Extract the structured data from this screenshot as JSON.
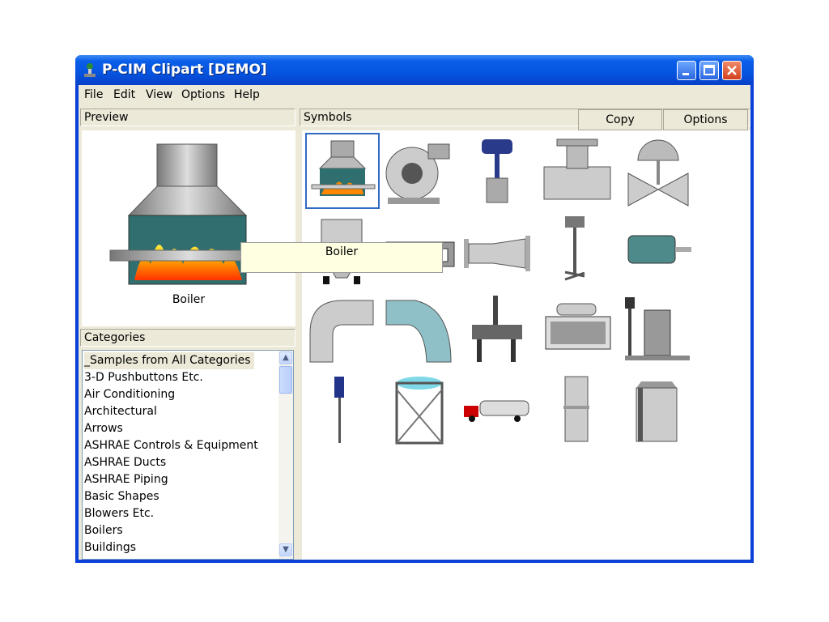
{
  "window": {
    "title": "P-CIM Clipart [DEMO]"
  },
  "menu": [
    "File",
    "Edit",
    "View",
    "Options",
    "Help"
  ],
  "preview": {
    "header": "Preview",
    "label": "Boiler"
  },
  "categories": {
    "header": "Categories",
    "items": [
      "_Samples from All Categories",
      "3-D Pushbuttons Etc.",
      "Air Conditioning",
      "Architectural",
      "Arrows",
      "ASHRAE Controls & Equipment",
      "ASHRAE Ducts",
      "ASHRAE Piping",
      "Basic Shapes",
      "Blowers Etc.",
      "Boilers",
      "Buildings"
    ],
    "selected": "_Samples from All Categories"
  },
  "symbols": {
    "header": "Symbols",
    "copy_label": "Copy",
    "options_label": "Options",
    "tooltip": "Boiler",
    "items": [
      "boiler",
      "blower",
      "control-valve",
      "pipe-tee",
      "valve",
      "hopper",
      "conveyor",
      "reducer",
      "mixer",
      "motor",
      "pipe-elbow",
      "duct-elbow",
      "oil-platform",
      "air-conditioner",
      "tank-scale",
      "probe",
      "water-tower",
      "tanker-truck",
      "duct",
      "silo"
    ]
  }
}
